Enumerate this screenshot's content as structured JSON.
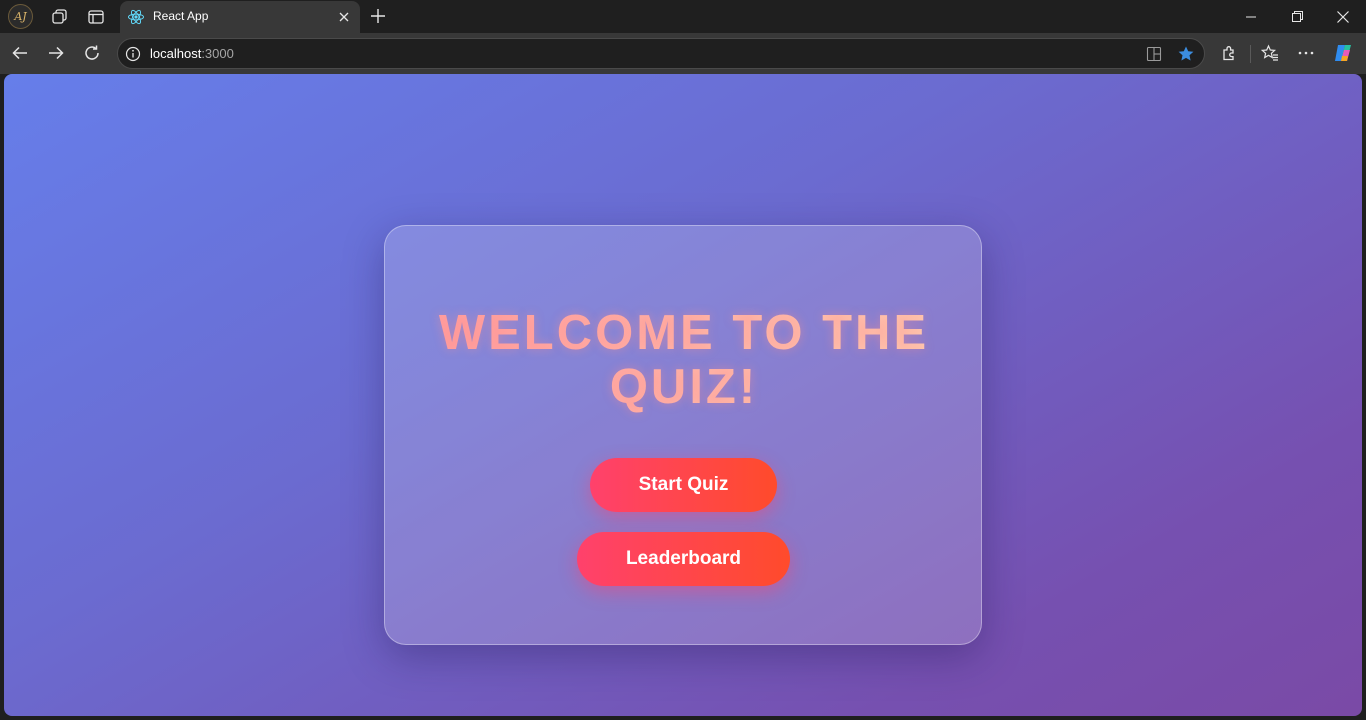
{
  "browser": {
    "profile_initials": "AJ",
    "tab": {
      "title": "React App",
      "favicon": "react-logo-icon"
    },
    "address": {
      "host": "localhost",
      "port": ":3000"
    }
  },
  "page": {
    "heading": "WELCOME TO THE QUIZ!",
    "buttons": {
      "start": "Start Quiz",
      "leaderboard": "Leaderboard"
    }
  },
  "colors": {
    "background_start": "#667eea",
    "background_end": "#764ba2",
    "button_gradient_start": "#ff416c",
    "button_gradient_end": "#ff4b2b",
    "heading": "#ffb0a8",
    "accent_star": "#3b8de0"
  }
}
